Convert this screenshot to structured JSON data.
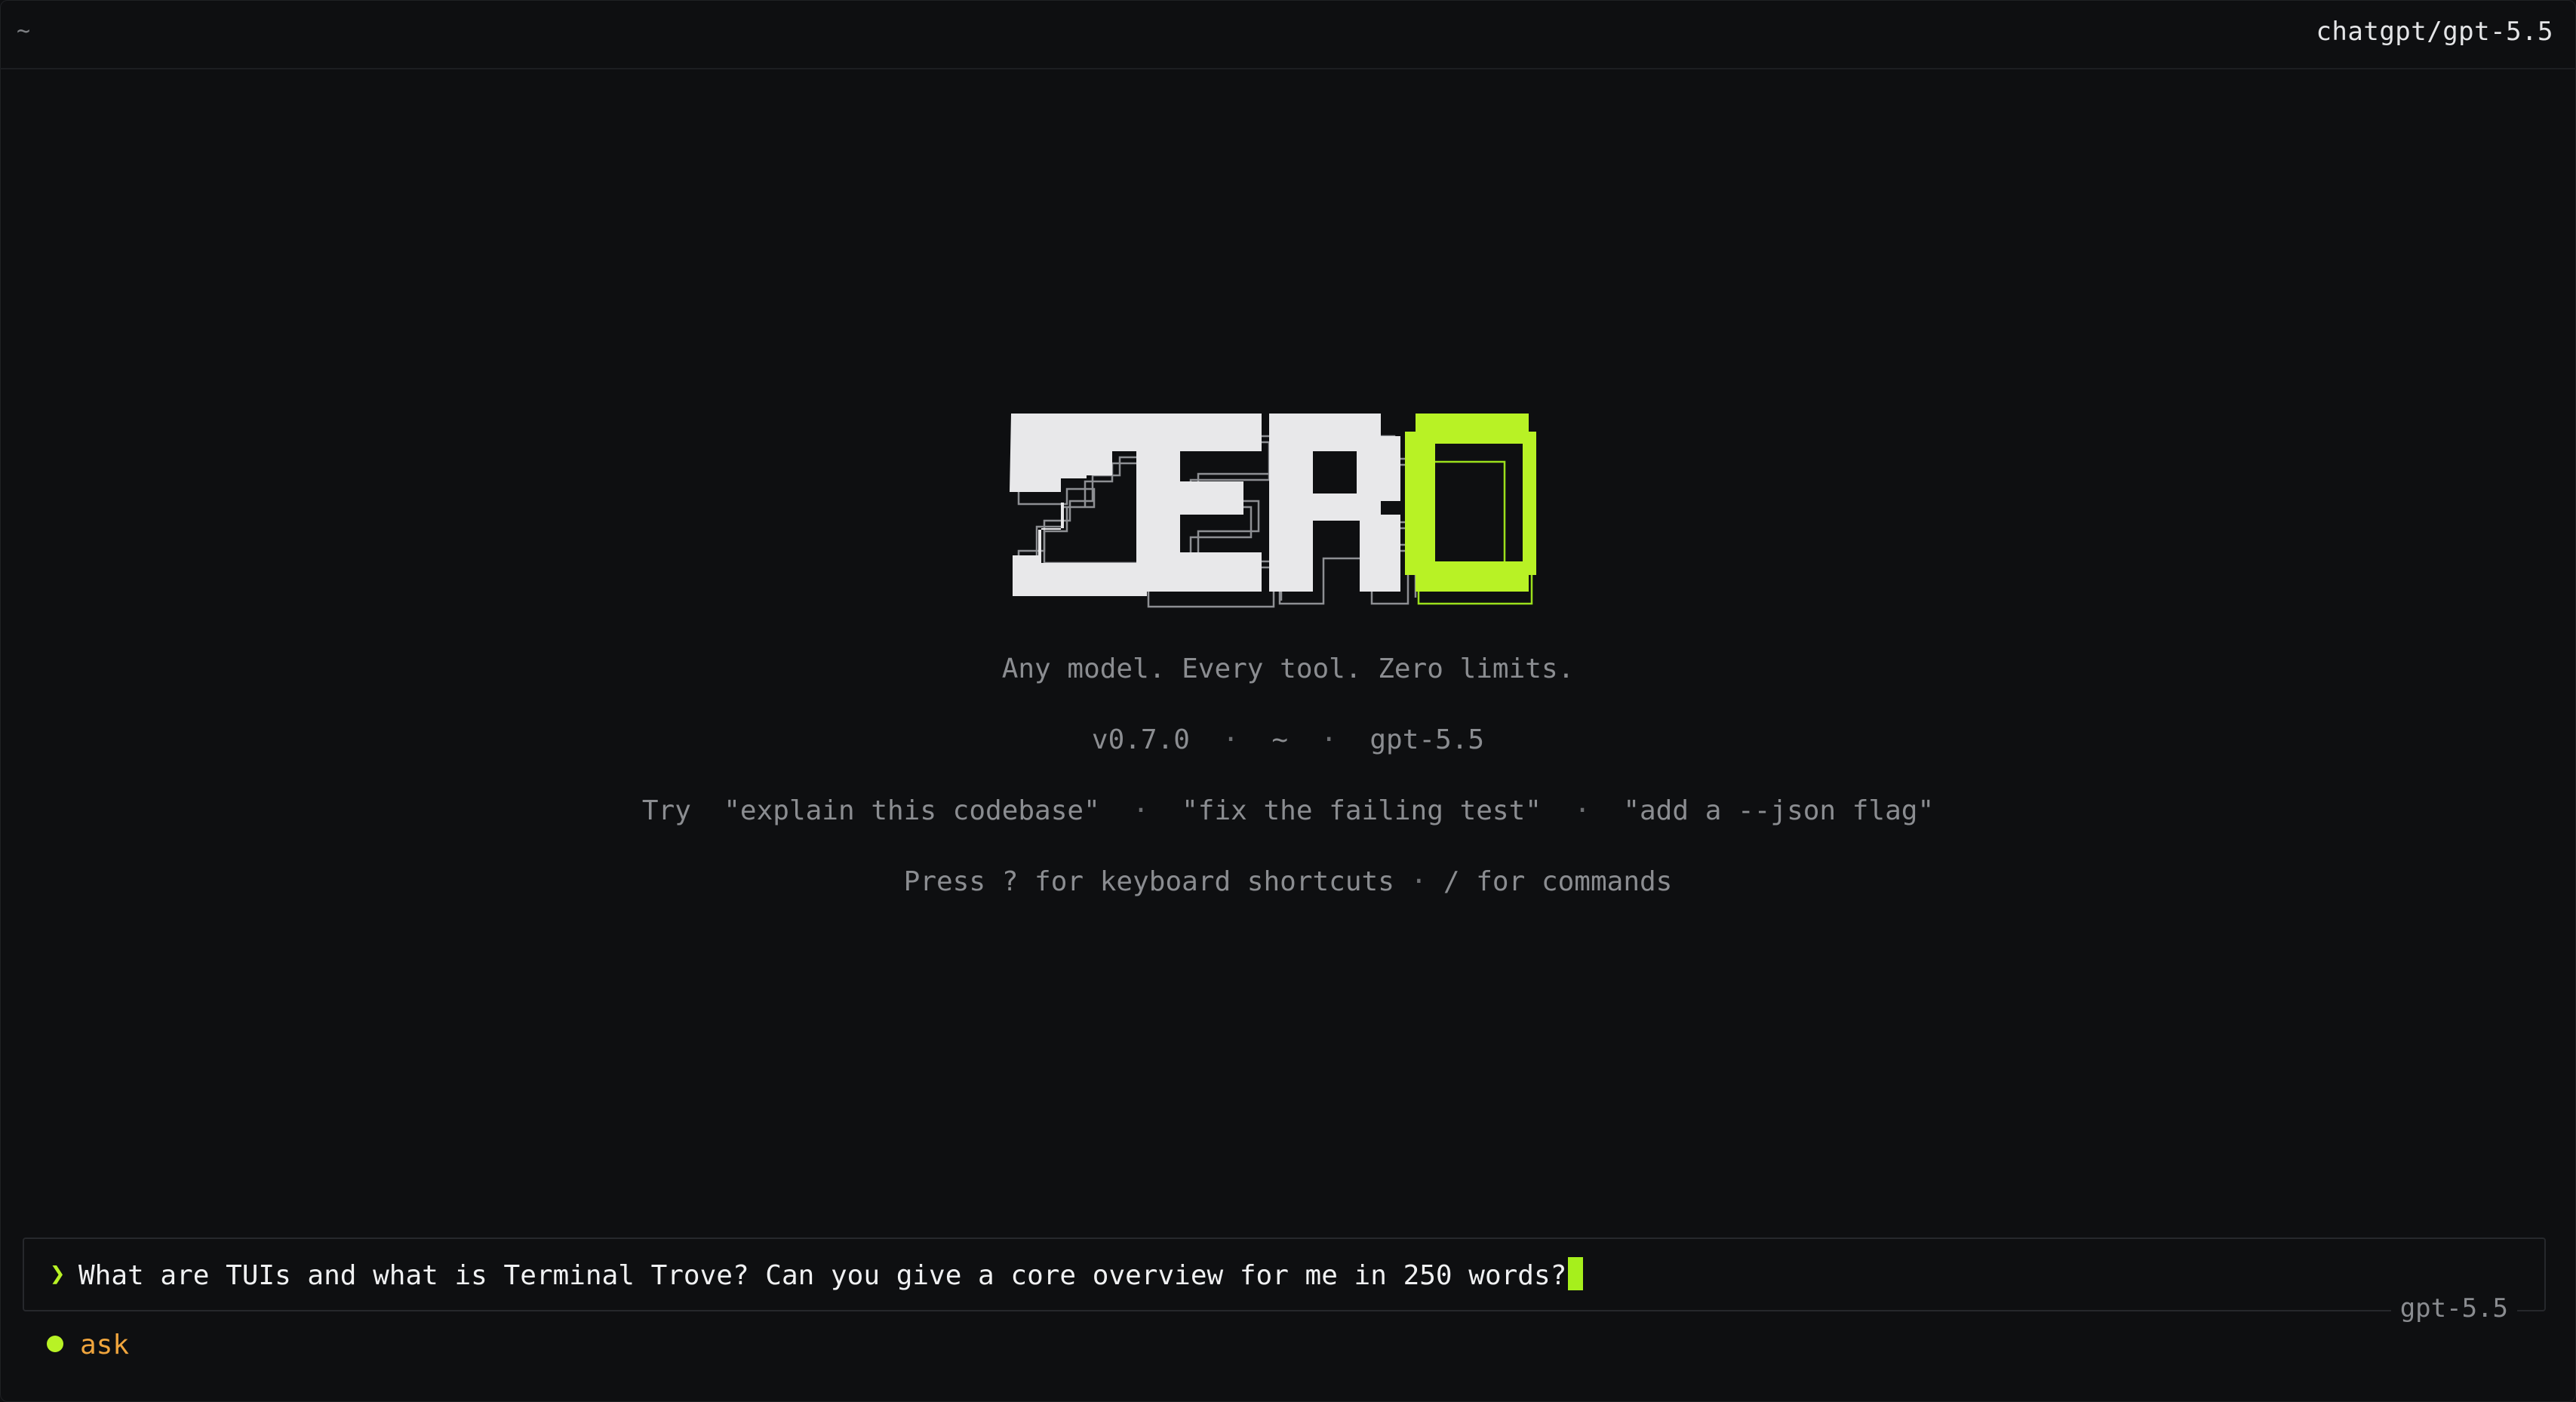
{
  "topbar": {
    "cwd": "~",
    "provider_model": "chatgpt/gpt-5.5"
  },
  "logo": {
    "text": "ZERO",
    "accent_color": "#b8f225",
    "base_color": "#e8e8ea"
  },
  "tagline": "Any model. Every tool. Zero limits.",
  "meta": {
    "version": "v0.7.0",
    "dir": "~",
    "model": "gpt-5.5"
  },
  "tips": {
    "lead": "Try",
    "examples": [
      "\"explain this codebase\"",
      "\"fix the failing test\"",
      "\"add a --json flag\""
    ]
  },
  "hint": {
    "text_1": "Press ? for keyboard shortcuts",
    "text_2": "/ for commands"
  },
  "prompt": {
    "chevron": "❯",
    "value": "What are TUIs and what is Terminal Trove? Can you give a core overview for me in 250 words?",
    "model_label": "gpt-5.5"
  },
  "mode": {
    "label": "ask",
    "dot_color": "#b8f225",
    "label_color": "#f0a53d"
  }
}
